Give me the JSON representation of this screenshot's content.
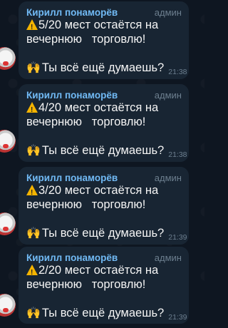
{
  "messages": [
    {
      "sender": "Кирилл понаморёв",
      "role": "админ",
      "line1": "5/20 мест остаётся на",
      "line2": "вечернюю   торговлю!",
      "line3": "Ты всё ещё думаешь?",
      "time": "21:38",
      "warning_icon": "warning-icon",
      "hands_icon": "raised-hands-icon"
    },
    {
      "sender": "Кирилл понаморёв",
      "role": "админ",
      "line1": "4/20 мест остаётся на",
      "line2": "вечернюю   торговлю!",
      "line3": "Ты всё ещё думаешь?",
      "time": "21:38",
      "warning_icon": "warning-icon",
      "hands_icon": "raised-hands-icon"
    },
    {
      "sender": "Кирилл понаморёв",
      "role": "админ",
      "line1": "3/20 мест остаётся на",
      "line2": "вечернюю   торговлю!",
      "line3": "Ты всё ещё думаешь?",
      "time": "21:39",
      "warning_icon": "warning-icon",
      "hands_icon": "raised-hands-icon"
    },
    {
      "sender": "Кирилл понаморёв",
      "role": "админ",
      "line1": "2/20 мест остаётся на",
      "line2": "вечернюю   торговлю!",
      "line3": "Ты всё ещё думаешь?",
      "time": "21:39",
      "warning_icon": "warning-icon",
      "hands_icon": "raised-hands-icon"
    }
  ],
  "colors": {
    "background": "#0e1621",
    "bubble": "#182533",
    "sender": "#71baf5",
    "meta": "#6d7f8f",
    "text": "#f5f5f5"
  }
}
